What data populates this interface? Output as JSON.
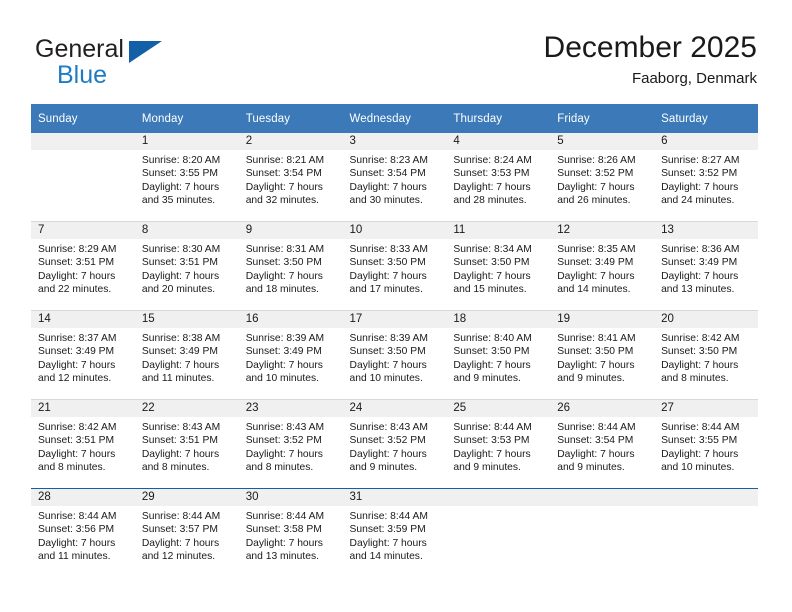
{
  "brand": {
    "name_part1": "General",
    "name_part2": "Blue",
    "logo_icon": "triangle-logo-icon"
  },
  "header": {
    "month_title": "December 2025",
    "location": "Faaborg, Denmark"
  },
  "colors": {
    "header_blue": "#3b79b8",
    "brand_blue": "#1f7cc2",
    "logo_blue": "#1360a8",
    "band_gray": "#f0f0f0",
    "row_divider": "#d8d8d8",
    "text": "#1a1a1a"
  },
  "calendar": {
    "weekday_headers": [
      "Sunday",
      "Monday",
      "Tuesday",
      "Wednesday",
      "Thursday",
      "Friday",
      "Saturday"
    ],
    "weeks": [
      [
        {
          "day": "",
          "lines": []
        },
        {
          "day": "1",
          "lines": [
            "Sunrise: 8:20 AM",
            "Sunset: 3:55 PM",
            "Daylight: 7 hours",
            "and 35 minutes."
          ]
        },
        {
          "day": "2",
          "lines": [
            "Sunrise: 8:21 AM",
            "Sunset: 3:54 PM",
            "Daylight: 7 hours",
            "and 32 minutes."
          ]
        },
        {
          "day": "3",
          "lines": [
            "Sunrise: 8:23 AM",
            "Sunset: 3:54 PM",
            "Daylight: 7 hours",
            "and 30 minutes."
          ]
        },
        {
          "day": "4",
          "lines": [
            "Sunrise: 8:24 AM",
            "Sunset: 3:53 PM",
            "Daylight: 7 hours",
            "and 28 minutes."
          ]
        },
        {
          "day": "5",
          "lines": [
            "Sunrise: 8:26 AM",
            "Sunset: 3:52 PM",
            "Daylight: 7 hours",
            "and 26 minutes."
          ]
        },
        {
          "day": "6",
          "lines": [
            "Sunrise: 8:27 AM",
            "Sunset: 3:52 PM",
            "Daylight: 7 hours",
            "and 24 minutes."
          ]
        }
      ],
      [
        {
          "day": "7",
          "lines": [
            "Sunrise: 8:29 AM",
            "Sunset: 3:51 PM",
            "Daylight: 7 hours",
            "and 22 minutes."
          ]
        },
        {
          "day": "8",
          "lines": [
            "Sunrise: 8:30 AM",
            "Sunset: 3:51 PM",
            "Daylight: 7 hours",
            "and 20 minutes."
          ]
        },
        {
          "day": "9",
          "lines": [
            "Sunrise: 8:31 AM",
            "Sunset: 3:50 PM",
            "Daylight: 7 hours",
            "and 18 minutes."
          ]
        },
        {
          "day": "10",
          "lines": [
            "Sunrise: 8:33 AM",
            "Sunset: 3:50 PM",
            "Daylight: 7 hours",
            "and 17 minutes."
          ]
        },
        {
          "day": "11",
          "lines": [
            "Sunrise: 8:34 AM",
            "Sunset: 3:50 PM",
            "Daylight: 7 hours",
            "and 15 minutes."
          ]
        },
        {
          "day": "12",
          "lines": [
            "Sunrise: 8:35 AM",
            "Sunset: 3:49 PM",
            "Daylight: 7 hours",
            "and 14 minutes."
          ]
        },
        {
          "day": "13",
          "lines": [
            "Sunrise: 8:36 AM",
            "Sunset: 3:49 PM",
            "Daylight: 7 hours",
            "and 13 minutes."
          ]
        }
      ],
      [
        {
          "day": "14",
          "lines": [
            "Sunrise: 8:37 AM",
            "Sunset: 3:49 PM",
            "Daylight: 7 hours",
            "and 12 minutes."
          ]
        },
        {
          "day": "15",
          "lines": [
            "Sunrise: 8:38 AM",
            "Sunset: 3:49 PM",
            "Daylight: 7 hours",
            "and 11 minutes."
          ]
        },
        {
          "day": "16",
          "lines": [
            "Sunrise: 8:39 AM",
            "Sunset: 3:49 PM",
            "Daylight: 7 hours",
            "and 10 minutes."
          ]
        },
        {
          "day": "17",
          "lines": [
            "Sunrise: 8:39 AM",
            "Sunset: 3:50 PM",
            "Daylight: 7 hours",
            "and 10 minutes."
          ]
        },
        {
          "day": "18",
          "lines": [
            "Sunrise: 8:40 AM",
            "Sunset: 3:50 PM",
            "Daylight: 7 hours",
            "and 9 minutes."
          ]
        },
        {
          "day": "19",
          "lines": [
            "Sunrise: 8:41 AM",
            "Sunset: 3:50 PM",
            "Daylight: 7 hours",
            "and 9 minutes."
          ]
        },
        {
          "day": "20",
          "lines": [
            "Sunrise: 8:42 AM",
            "Sunset: 3:50 PM",
            "Daylight: 7 hours",
            "and 8 minutes."
          ]
        }
      ],
      [
        {
          "day": "21",
          "lines": [
            "Sunrise: 8:42 AM",
            "Sunset: 3:51 PM",
            "Daylight: 7 hours",
            "and 8 minutes."
          ]
        },
        {
          "day": "22",
          "lines": [
            "Sunrise: 8:43 AM",
            "Sunset: 3:51 PM",
            "Daylight: 7 hours",
            "and 8 minutes."
          ]
        },
        {
          "day": "23",
          "lines": [
            "Sunrise: 8:43 AM",
            "Sunset: 3:52 PM",
            "Daylight: 7 hours",
            "and 8 minutes."
          ]
        },
        {
          "day": "24",
          "lines": [
            "Sunrise: 8:43 AM",
            "Sunset: 3:52 PM",
            "Daylight: 7 hours",
            "and 9 minutes."
          ]
        },
        {
          "day": "25",
          "lines": [
            "Sunrise: 8:44 AM",
            "Sunset: 3:53 PM",
            "Daylight: 7 hours",
            "and 9 minutes."
          ]
        },
        {
          "day": "26",
          "lines": [
            "Sunrise: 8:44 AM",
            "Sunset: 3:54 PM",
            "Daylight: 7 hours",
            "and 9 minutes."
          ]
        },
        {
          "day": "27",
          "lines": [
            "Sunrise: 8:44 AM",
            "Sunset: 3:55 PM",
            "Daylight: 7 hours",
            "and 10 minutes."
          ]
        }
      ],
      [
        {
          "day": "28",
          "lines": [
            "Sunrise: 8:44 AM",
            "Sunset: 3:56 PM",
            "Daylight: 7 hours",
            "and 11 minutes."
          ]
        },
        {
          "day": "29",
          "lines": [
            "Sunrise: 8:44 AM",
            "Sunset: 3:57 PM",
            "Daylight: 7 hours",
            "and 12 minutes."
          ]
        },
        {
          "day": "30",
          "lines": [
            "Sunrise: 8:44 AM",
            "Sunset: 3:58 PM",
            "Daylight: 7 hours",
            "and 13 minutes."
          ]
        },
        {
          "day": "31",
          "lines": [
            "Sunrise: 8:44 AM",
            "Sunset: 3:59 PM",
            "Daylight: 7 hours",
            "and 14 minutes."
          ]
        },
        {
          "day": "",
          "lines": []
        },
        {
          "day": "",
          "lines": []
        },
        {
          "day": "",
          "lines": []
        }
      ]
    ]
  }
}
